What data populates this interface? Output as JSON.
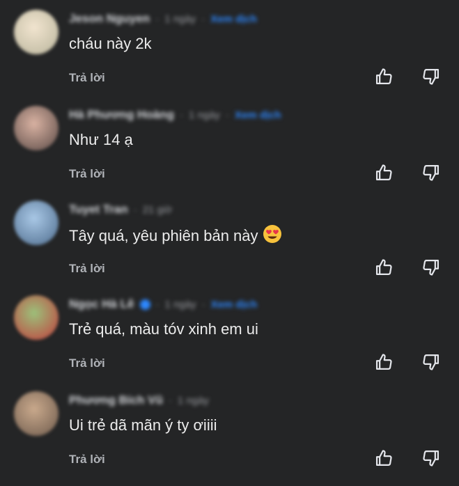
{
  "comments": [
    {
      "author": "Jeson Nguyen",
      "time": "1 ngày",
      "see_translation": "Xem dịch",
      "text": "cháu này 2k",
      "reply_label": "Trả lời",
      "verified": false,
      "avatar_colors": [
        "#f1e4cf",
        "#b8b49b"
      ]
    },
    {
      "author": "Hà Phương Hoàng",
      "time": "1 ngày",
      "see_translation": "Xem dịch",
      "text": "Như 14 ạ",
      "reply_label": "Trả lời",
      "verified": false,
      "avatar_colors": [
        "#d9b2a2",
        "#5a4a46"
      ]
    },
    {
      "author": "Tuyet Tran",
      "time": "21 giờ",
      "see_translation": "",
      "text": "Tây quá, yêu phiên bản này",
      "emoji": "heart-eyes-emoji",
      "reply_label": "Trả lời",
      "verified": false,
      "avatar_colors": [
        "#a9c8e6",
        "#4d6b8c"
      ]
    },
    {
      "author": "Ngọc Hà Lê",
      "time": "1 ngày",
      "see_translation": "Xem dịch",
      "text": "Trẻ quá, màu tóv xinh em ui",
      "reply_label": "Trả lời",
      "verified": true,
      "avatar_colors": [
        "#9cc07a",
        "#c23c3c"
      ]
    },
    {
      "author": "Phương Bích Vũ",
      "time": "1 ngày",
      "see_translation": "",
      "text": "Ui trẻ dã mãn ý ty ơiiii",
      "reply_label": "Trả lời",
      "verified": false,
      "avatar_colors": [
        "#c9a98c",
        "#6d5a4c"
      ]
    }
  ],
  "icons": {
    "like": "thumbs-up-icon",
    "dislike": "thumbs-down-icon"
  },
  "colors": {
    "background": "#242526",
    "text": "#ececec",
    "secondary": "#b0b3b8",
    "link": "#2d88ff"
  }
}
